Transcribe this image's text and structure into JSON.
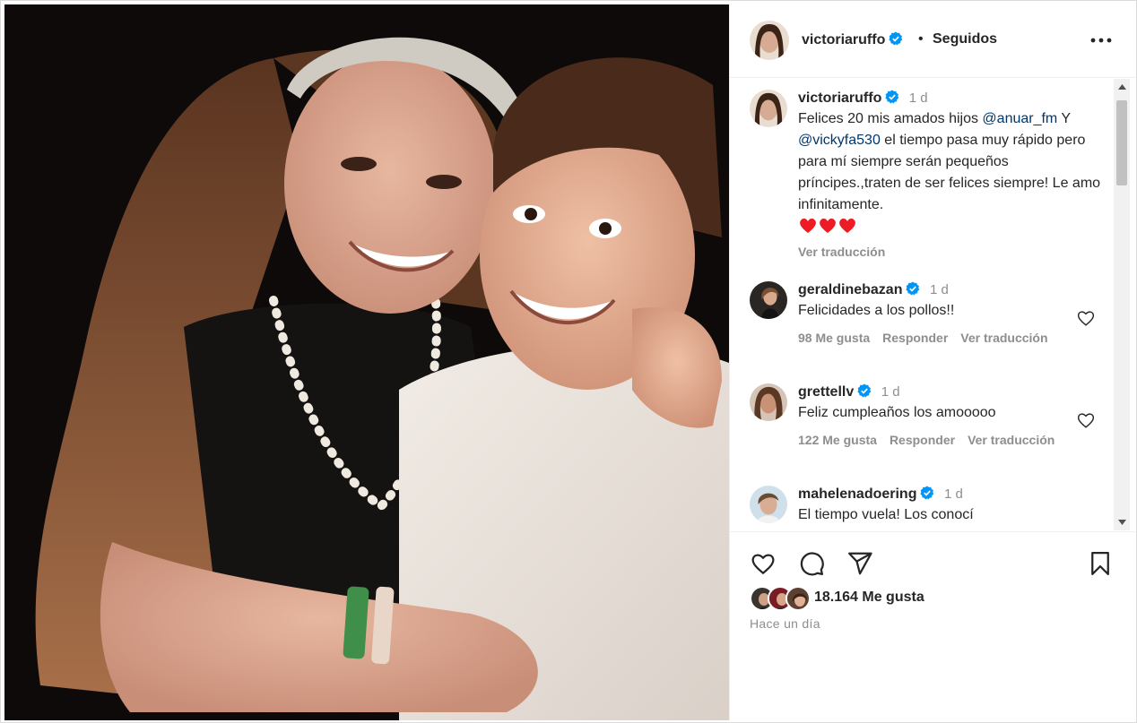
{
  "header": {
    "username": "victoriaruffo",
    "separator": "•",
    "follow_status": "Seguidos",
    "more_icon": "more-horizontal-icon"
  },
  "caption": {
    "username": "victoriaruffo",
    "time": "1 d",
    "text_before": "Felices 20 mis amados hijos ",
    "mention1": "@anuar_fm",
    "text_mid": " Y ",
    "mention2": "@vickyfa530",
    "text_after": " el tiempo pasa muy rápido pero para mí siempre serán pequeños príncipes.,traten de ser felices siempre! Le amo infinitamente.",
    "emoji": "❤️❤️❤️",
    "translate": "Ver traducción"
  },
  "comments": [
    {
      "username": "geraldinebazan",
      "time": "1 d",
      "text": "Felicidades a los pollos!!",
      "likes": "98 Me gusta",
      "reply": "Responder",
      "translate": "Ver traducción"
    },
    {
      "username": "grettellv",
      "time": "1 d",
      "text": "Feliz cumpleaños los amooooo",
      "likes": "122 Me gusta",
      "reply": "Responder",
      "translate": "Ver traducción"
    },
    {
      "username": "mahelenadoering",
      "time": "1 d",
      "text": "El tiempo vuela! Los conocí"
    }
  ],
  "footer": {
    "like_count": "18.164 Me gusta",
    "time_ago": "Hace un día"
  },
  "colors": {
    "verified": "#0095f6",
    "mention": "#00376b",
    "secondary_text": "#8e8e8e",
    "heart_red": "#ed1c24"
  }
}
